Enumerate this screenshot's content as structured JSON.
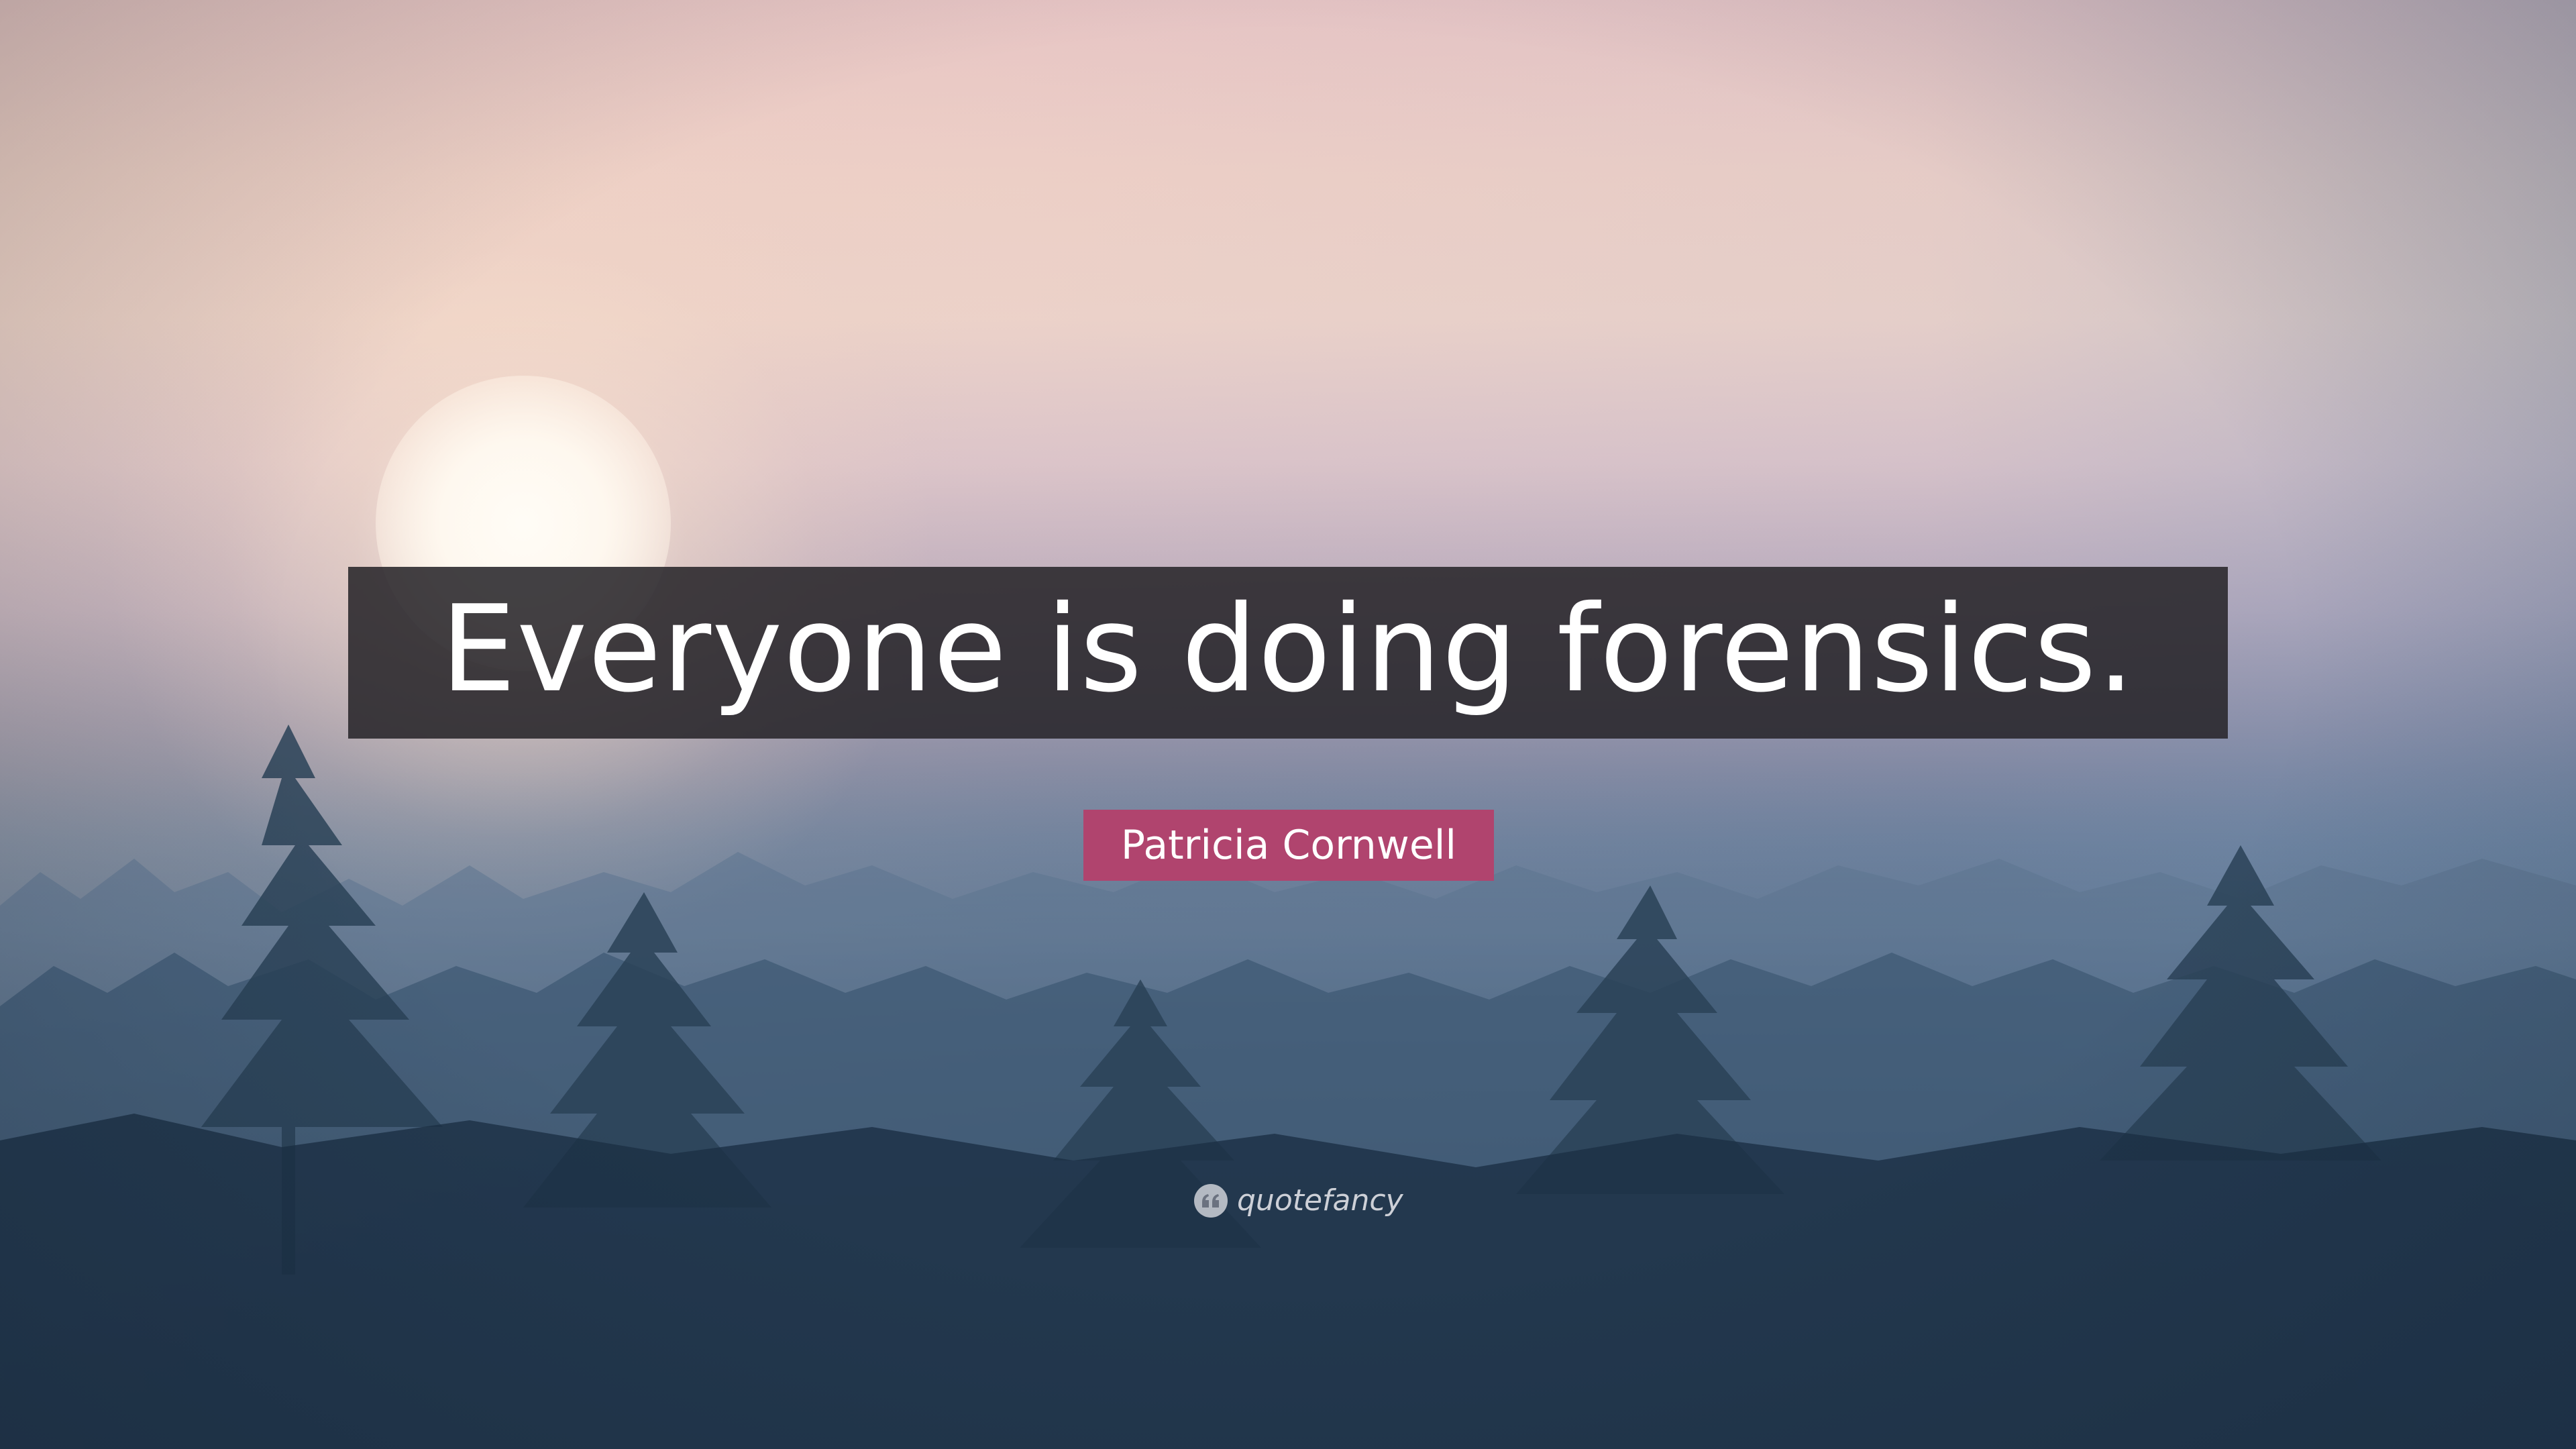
{
  "quote": {
    "text": "Everyone is doing forensics."
  },
  "author": {
    "name": "Patricia Cornwell"
  },
  "brand": {
    "name": "quotefancy",
    "icon": "quote-marks-icon"
  },
  "colors": {
    "quote_box": "#28262a",
    "author_box": "#b0446e",
    "text": "#ffffff"
  }
}
